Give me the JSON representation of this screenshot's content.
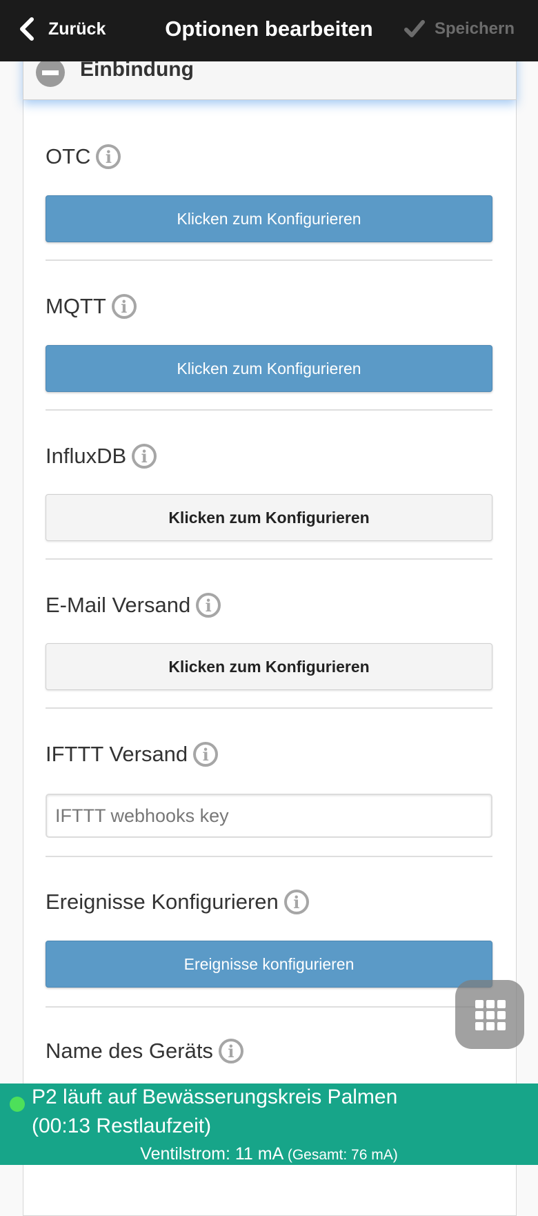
{
  "header": {
    "back_label": "Zurück",
    "title": "Optionen bearbeiten",
    "save_label": "Speichern"
  },
  "section": {
    "title": "Einbindung"
  },
  "fields": {
    "otc": {
      "label": "OTC",
      "button": "Klicken zum Konfigurieren"
    },
    "mqtt": {
      "label": "MQTT",
      "button": "Klicken zum Konfigurieren"
    },
    "influxdb": {
      "label": "InfluxDB",
      "button": "Klicken zum Konfigurieren"
    },
    "email": {
      "label": "E-Mail Versand",
      "button": "Klicken zum Konfigurieren"
    },
    "ifttt": {
      "label": "IFTTT Versand",
      "placeholder": "IFTTT webhooks key",
      "value": ""
    },
    "events": {
      "label": "Ereignisse Konfigurieren",
      "button": "Ereignisse konfigurieren"
    },
    "device_name": {
      "label": "Name des Geräts"
    }
  },
  "info_glyph": "i",
  "status": {
    "line1": "P2 läuft auf Bewässerungskreis Palmen",
    "line2": "(00:13 Restlaufzeit)",
    "current": "Ventilstrom: 11 mA",
    "total": "(Gesamt: 76 mA)"
  },
  "colors": {
    "header_bg": "#1b1b1b",
    "primary_button": "#5b9ac7",
    "status_bar": "#17a589",
    "status_dot": "#4de05a"
  }
}
